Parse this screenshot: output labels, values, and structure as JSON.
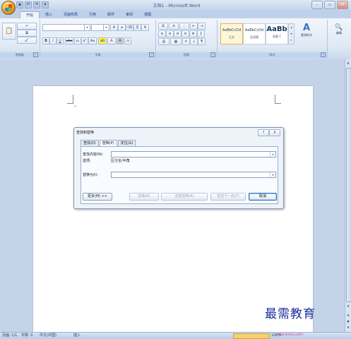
{
  "window": {
    "title": "文档1 - Microsoft Word"
  },
  "quick_access": {
    "items": [
      "save-icon",
      "undo-icon",
      "redo-icon",
      "customize-icon"
    ]
  },
  "ribbon": {
    "tabs": [
      {
        "label": "开始",
        "active": true
      },
      {
        "label": "插入",
        "active": false
      },
      {
        "label": "页面布局",
        "active": false
      },
      {
        "label": "引用",
        "active": false
      },
      {
        "label": "邮件",
        "active": false
      },
      {
        "label": "审阅",
        "active": false
      },
      {
        "label": "视图",
        "active": false
      }
    ],
    "groups": {
      "clipboard": "剪贴板",
      "font": "字体",
      "paragraph": "段落",
      "styles": "样式",
      "editing": "编辑"
    },
    "styles": [
      {
        "sample": "AaBbCcDd",
        "name": "正文"
      },
      {
        "sample": "AaBbCcDd",
        "name": "无间隔"
      },
      {
        "sample": "AaBb",
        "name": "标题 1"
      }
    ],
    "change_styles": "更改样式",
    "edit_label": "编辑"
  },
  "dialog": {
    "title": "查找和替换",
    "help": "?",
    "close": "X",
    "tabs": [
      {
        "label": "查找(D)",
        "active": false
      },
      {
        "label": "替换(P)",
        "active": true
      },
      {
        "label": "定位(G)",
        "active": false
      }
    ],
    "find_label": "查找内容(N):",
    "options_label": "选项:",
    "options_value": "区分全/半角",
    "replace_label": "替换为(I):",
    "find_value": "",
    "replace_value": "",
    "buttons": {
      "more": "更多(M) >>",
      "replace": "替换(R)",
      "replace_all": "全部替换(A)",
      "find_next": "查找下一处(F)",
      "cancel": "取消"
    }
  },
  "status_bar": {
    "page": "页面: 1/1",
    "words": "字数: 0",
    "language": "中文(中国)",
    "mode": "插入",
    "zoom": "100%"
  },
  "watermark": {
    "text": "最需教育",
    "url": "www.zuixu.com"
  }
}
